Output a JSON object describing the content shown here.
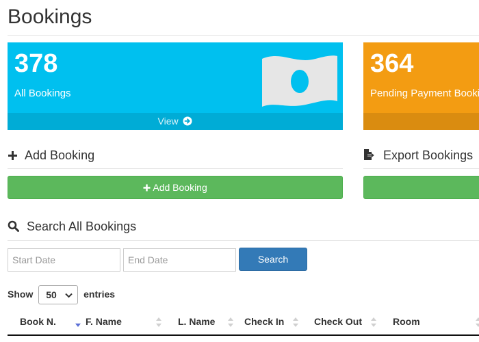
{
  "page": {
    "title": "Bookings"
  },
  "stats": [
    {
      "number": "378",
      "label": "All Bookings",
      "footer": "View",
      "icon": "money-icon",
      "color": "#00c0ef"
    },
    {
      "number": "364",
      "label": "Pending Payment Bookings",
      "color": "#f39c12"
    }
  ],
  "add": {
    "title": "Add Booking",
    "button_label": "Add Booking",
    "icon": "plus-icon"
  },
  "export": {
    "title": "Export Bookings",
    "icon": "file-export-icon"
  },
  "search": {
    "title": "Search All Bookings",
    "start_placeholder": "Start Date",
    "end_placeholder": "End Date",
    "button_label": "Search",
    "icon": "search-icon"
  },
  "entries": {
    "show": "Show",
    "value": "50",
    "suffix": "entries"
  },
  "table": {
    "columns": [
      "Book N.",
      "F. Name",
      "L. Name",
      "Check In",
      "Check Out",
      "Room"
    ]
  },
  "colors": {
    "success": "#5cb85c",
    "primary": "#337ab7",
    "info": "#00c0ef",
    "warning": "#f39c12"
  }
}
